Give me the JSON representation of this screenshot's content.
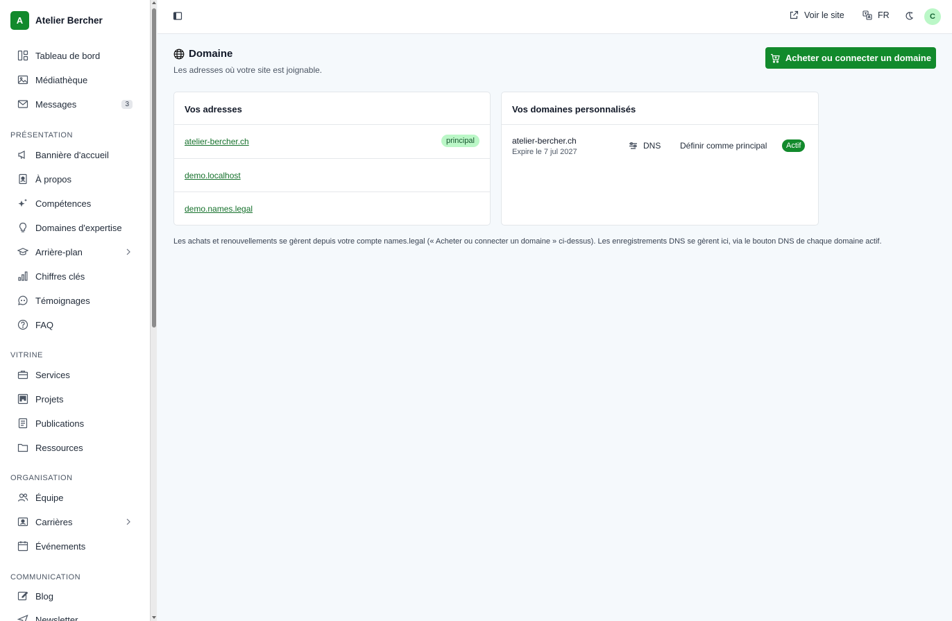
{
  "brand": {
    "initial": "A",
    "name": "Atelier Bercher"
  },
  "sidebar": {
    "items": [
      {
        "label": "Tableau de bord",
        "icon": "dashboard-icon"
      },
      {
        "label": "Médiathèque",
        "icon": "image-icon"
      },
      {
        "label": "Messages",
        "icon": "mail-icon",
        "badge": "3"
      }
    ],
    "sections": [
      {
        "title": "PRÉSENTATION",
        "items": [
          {
            "label": "Bannière d'accueil",
            "icon": "megaphone-icon"
          },
          {
            "label": "À propos",
            "icon": "id-card-icon"
          },
          {
            "label": "Compétences",
            "icon": "sparkles-icon"
          },
          {
            "label": "Domaines d'expertise",
            "icon": "lightbulb-icon"
          },
          {
            "label": "Arrière-plan",
            "icon": "graduation-cap-icon"
          },
          {
            "label": "Chiffres clés",
            "icon": "bar-chart-icon"
          },
          {
            "label": "Témoignages",
            "icon": "quote-bubble-icon"
          },
          {
            "label": "FAQ",
            "icon": "help-circle-icon"
          }
        ]
      },
      {
        "title": "VITRINE",
        "items": [
          {
            "label": "Services",
            "icon": "briefcase-icon"
          },
          {
            "label": "Projets",
            "icon": "kanban-icon"
          },
          {
            "label": "Publications",
            "icon": "document-icon"
          },
          {
            "label": "Ressources",
            "icon": "folder-icon"
          }
        ]
      },
      {
        "title": "ORGANISATION",
        "items": [
          {
            "label": "Équipe",
            "icon": "users-icon"
          },
          {
            "label": "Carrières",
            "icon": "badge-icon"
          },
          {
            "label": "Événements",
            "icon": "calendar-icon"
          }
        ]
      },
      {
        "title": "COMMUNICATION",
        "items": [
          {
            "label": "Blog",
            "icon": "edit-icon"
          },
          {
            "label": "Newsletter",
            "icon": "send-icon"
          }
        ]
      }
    ]
  },
  "topbar": {
    "view_site": "Voir le site",
    "language": "FR",
    "avatar": "C"
  },
  "page": {
    "title": "Domaine",
    "subtitle": "Les adresses où votre site est joignable.",
    "cta": "Acheter ou connecter un domaine"
  },
  "addresses": {
    "title": "Vos adresses",
    "items": [
      "atelier-bercher.ch",
      "demo.localhost",
      "demo.names.legal"
    ],
    "primary_label": "principal"
  },
  "custom_domains": {
    "title": "Vos domaines personnalisés",
    "domain": "atelier-bercher.ch",
    "expires": "Expire le 7 jul 2027",
    "dns_label": "DNS",
    "set_primary": "Définir comme principal",
    "status": "Actif"
  },
  "footnote": "Les achats et renouvellements se gèrent depuis votre compte names.legal (« Acheter ou connecter un domaine » ci-dessus). Les enregistrements DNS se gèrent ici, via le bouton DNS de chaque domaine actif.",
  "colors": {
    "accent": "#128a2c",
    "pill_light": "#bbf7c7",
    "background": "#f5f9fc"
  }
}
